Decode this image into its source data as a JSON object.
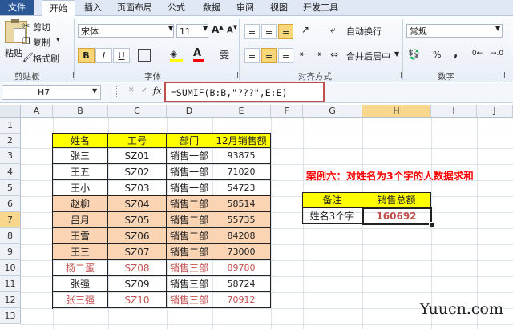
{
  "tabs": [
    "文件",
    "开始",
    "插入",
    "页面布局",
    "公式",
    "数据",
    "审阅",
    "视图",
    "开发工具"
  ],
  "clipboard": {
    "paste": "粘贴",
    "cut": "剪切",
    "copy": "复制",
    "copy_arrow": "▾",
    "format_painter": "格式刷",
    "group": "剪贴板"
  },
  "font": {
    "name": "宋体",
    "size": "11",
    "bold": "B",
    "italic": "I",
    "underline": "U",
    "group": "字体",
    "fill_color": "#ffff00",
    "font_color": "#ff0000"
  },
  "alignment": {
    "wrap": "自动换行",
    "merge": "合并后居中",
    "group": "对齐方式"
  },
  "number": {
    "format": "常规",
    "percent": "%",
    "comma": ",",
    "group": "数字"
  },
  "formula_bar": {
    "name_box": "H7",
    "fx": "fx",
    "formula": "=SUMIF(B:B,\"???\",E:E)"
  },
  "columns": [
    "A",
    "B",
    "C",
    "D",
    "E",
    "F",
    "G",
    "H",
    "I",
    "J"
  ],
  "rows": [
    "1",
    "2",
    "3",
    "4",
    "5",
    "6",
    "7",
    "8",
    "9",
    "10",
    "11",
    "12",
    "13"
  ],
  "table": {
    "headers": [
      "姓名",
      "工号",
      "部门",
      "12月销售额"
    ],
    "rows": [
      [
        "张三",
        "SZ01",
        "销售一部",
        "93875"
      ],
      [
        "王五",
        "SZ02",
        "销售一部",
        "71020"
      ],
      [
        "王小",
        "SZ03",
        "销售一部",
        "54723"
      ],
      [
        "赵柳",
        "SZ04",
        "销售二部",
        "58514"
      ],
      [
        "吕月",
        "SZ05",
        "销售二部",
        "55735"
      ],
      [
        "王雪",
        "SZ06",
        "销售二部",
        "84208"
      ],
      [
        "王三",
        "SZ07",
        "销售二部",
        "73000"
      ],
      [
        "杨二蛋",
        "SZ08",
        "销售三部",
        "89780"
      ],
      [
        "张强",
        "SZ09",
        "销售三部",
        "58724"
      ],
      [
        "张三强",
        "SZ10",
        "销售三部",
        "70912"
      ]
    ]
  },
  "case_title": "案例六：对姓名为3个字的人数据求和",
  "summary": {
    "header_left": "备注",
    "header_right": "销售总额",
    "label": "姓名3个字",
    "value": "160692"
  },
  "watermark": "Yuucn.com",
  "colors": {
    "header_yellow": "#ffff00",
    "peach": "#fbd4b4",
    "accent_red": "#c0504d",
    "title_red": "#ff0000"
  }
}
